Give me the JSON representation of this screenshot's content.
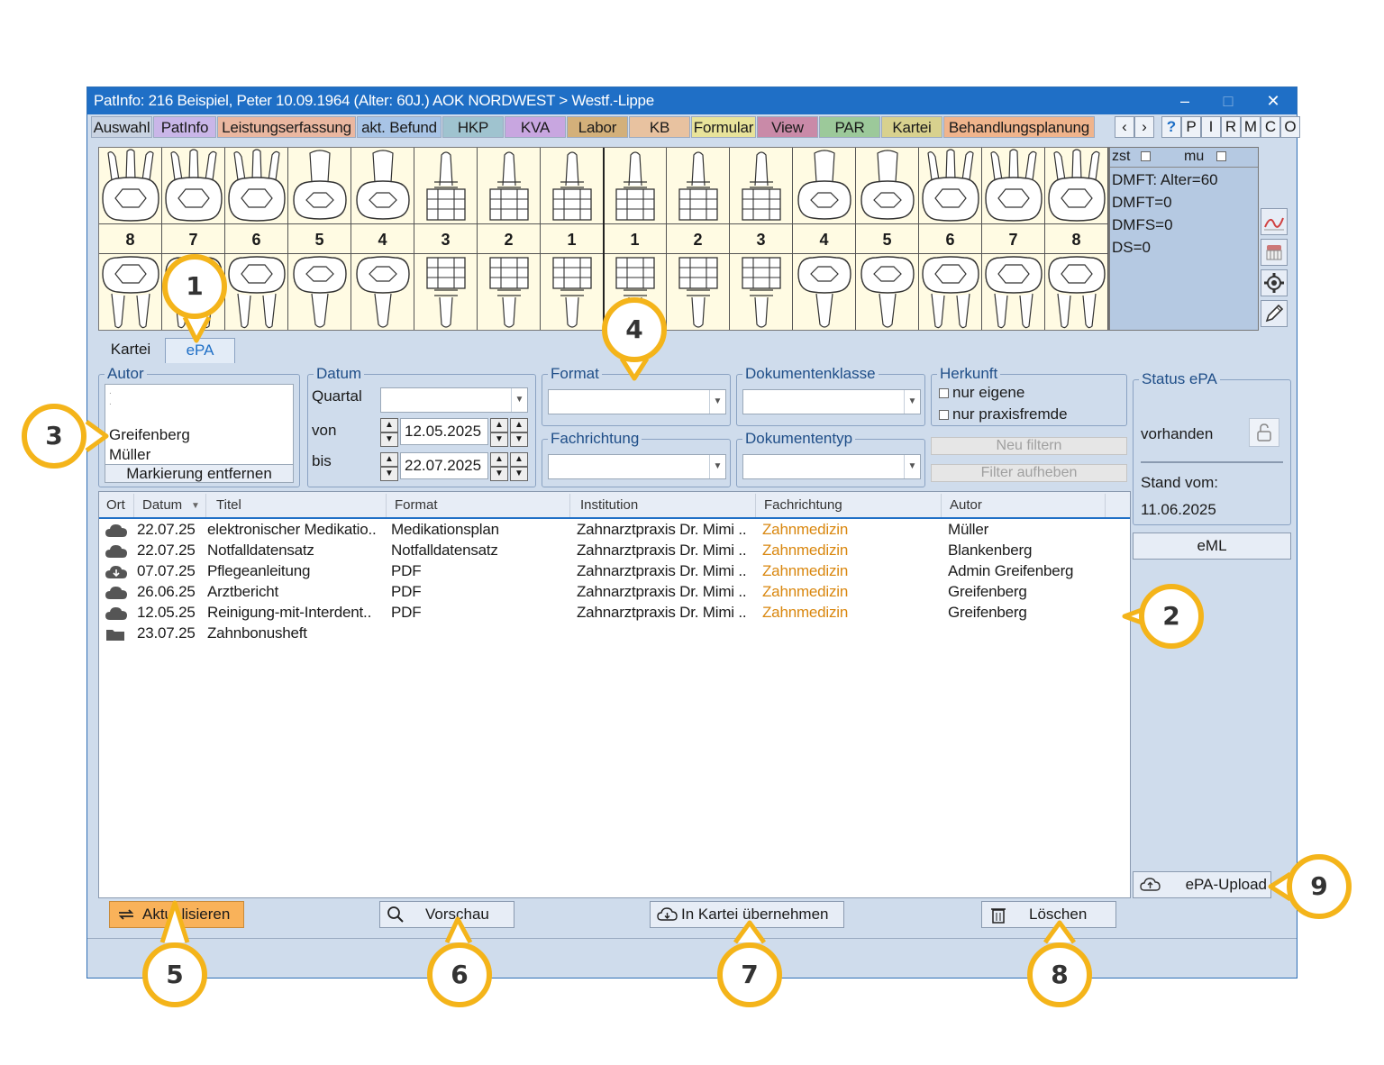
{
  "window": {
    "title": "PatInfo: 216  Beispiel, Peter  10.09.1964 (Alter: 60J.)  AOK NORDWEST > Westf.-Lippe",
    "controls": [
      "–",
      "□",
      "✕"
    ]
  },
  "tabs": [
    {
      "label": "Auswahl",
      "color": "#c9d3e2"
    },
    {
      "label": "PatInfo",
      "color": "#c9b6e8"
    },
    {
      "label": "Leistungserfassung",
      "color": "#eab7a0"
    },
    {
      "label": "akt. Befund",
      "color": "#a8c4e6"
    },
    {
      "label": "HKP",
      "color": "#9fc3cf"
    },
    {
      "label": "KVA",
      "color": "#c8a6e0"
    },
    {
      "label": "Labor",
      "color": "#d3b07a"
    },
    {
      "label": "KB",
      "color": "#e8c2a0"
    },
    {
      "label": "Formular",
      "color": "#e8e39a"
    },
    {
      "label": "View",
      "color": "#c98aa8"
    },
    {
      "label": "PAR",
      "color": "#9cc99a"
    },
    {
      "label": "Kartei",
      "color": "#d8d18e"
    },
    {
      "label": "Behandlungsplanung",
      "color": "#f0b48c"
    }
  ],
  "tab_nav": [
    "‹",
    "›",
    "?",
    "P",
    "I",
    "R",
    "M",
    "C",
    "O"
  ],
  "teeth": {
    "numbers": [
      "8",
      "7",
      "6",
      "5",
      "4",
      "3",
      "2",
      "1",
      "1",
      "2",
      "3",
      "4",
      "5",
      "6",
      "7",
      "8"
    ]
  },
  "dmft": {
    "zst_label": "zst",
    "mu_label": "mu",
    "lines": [
      "DMFT: Alter=60",
      "DMFT=0",
      "DMFS=0",
      "DS=0"
    ]
  },
  "subtabs": {
    "kartei": "Kartei",
    "epa": "ePA"
  },
  "filters": {
    "autor": {
      "legend": "Autor",
      "items": [
        ".",
        ".",
        "Greifenberg",
        "Müller"
      ],
      "clear_btn": "Markierung entfernen"
    },
    "datum": {
      "legend": "Datum",
      "quartal_label": "Quartal",
      "von_label": "von",
      "bis_label": "bis",
      "von_value": "12.05.2025",
      "bis_value": "22.07.2025"
    },
    "format": {
      "legend": "Format"
    },
    "dokumentenklasse": {
      "legend": "Dokumentenklasse"
    },
    "fachrichtung": {
      "legend": "Fachrichtung"
    },
    "dokumententyp": {
      "legend": "Dokumententyp"
    },
    "herkunft": {
      "legend": "Herkunft",
      "opt1": "nur eigene",
      "opt2": "nur praxisfremde"
    },
    "neu_filtern": "Neu filtern",
    "filter_aufheben": "Filter aufheben"
  },
  "status": {
    "legend": "Status ePA",
    "state": "vorhanden",
    "stand_label": "Stand vom:",
    "stand_date": "11.06.2025",
    "eml_btn": "eML",
    "upload_btn": "ePA-Upload"
  },
  "table": {
    "columns": [
      "Ort",
      "Datum",
      "Titel",
      "Format",
      "Institution",
      "Fachrichtung",
      "Autor"
    ],
    "fach_color": "#d9870f",
    "rows": [
      {
        "icon": "cloud",
        "datum": "22.07.25",
        "titel": "elektronischer Medikatio..",
        "format": "Medikationsplan",
        "institution": "Zahnarztpraxis Dr. Mimi ..",
        "fach": "Zahnmedizin",
        "autor": "Müller"
      },
      {
        "icon": "cloud",
        "datum": "22.07.25",
        "titel": "Notfalldatensatz",
        "format": "Notfalldatensatz",
        "institution": "Zahnarztpraxis Dr. Mimi ..",
        "fach": "Zahnmedizin",
        "autor": "Blankenberg"
      },
      {
        "icon": "cloud-download",
        "datum": "07.07.25",
        "titel": "Pflegeanleitung",
        "format": "PDF",
        "institution": "Zahnarztpraxis Dr. Mimi ..",
        "fach": "Zahnmedizin",
        "autor": "Admin Greifenberg"
      },
      {
        "icon": "cloud",
        "datum": "26.06.25",
        "titel": "Arztbericht",
        "format": "PDF",
        "institution": "Zahnarztpraxis Dr. Mimi ..",
        "fach": "Zahnmedizin",
        "autor": "Greifenberg"
      },
      {
        "icon": "cloud",
        "datum": "12.05.25",
        "titel": "Reinigung-mit-Interdent..",
        "format": "PDF",
        "institution": "Zahnarztpraxis Dr. Mimi ..",
        "fach": "Zahnmedizin",
        "autor": "Greifenberg"
      },
      {
        "icon": "folder",
        "datum": "23.07.25",
        "titel": "Zahnbonusheft",
        "format": "",
        "institution": "",
        "fach": "",
        "autor": ""
      }
    ]
  },
  "bottom_buttons": {
    "aktualisieren": "Aktualisieren",
    "vorschau": "Vorschau",
    "kartei": "In Kartei übernehmen",
    "loeschen": "Löschen"
  },
  "callouts": [
    "1",
    "2",
    "3",
    "4",
    "5",
    "6",
    "7",
    "8",
    "9"
  ],
  "accent": "#f4b41a"
}
